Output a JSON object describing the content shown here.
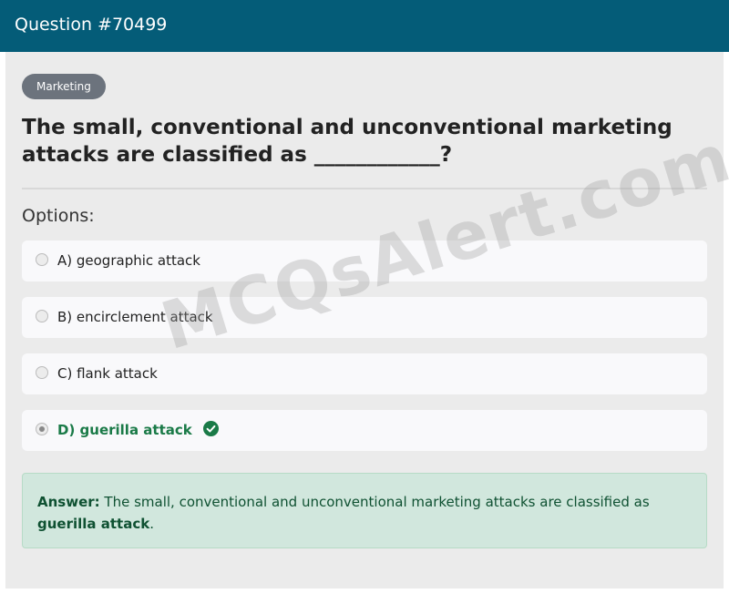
{
  "header": {
    "title": "Question #70499"
  },
  "category_badge": "Marketing",
  "question": "The small, conventional and unconventional marketing attacks are classified as ____________?",
  "options_label": "Options:",
  "options": [
    {
      "label": "A) geographic attack",
      "selected": false,
      "correct": false
    },
    {
      "label": "B) encirclement attack",
      "selected": false,
      "correct": false
    },
    {
      "label": "C) flank attack",
      "selected": false,
      "correct": false
    },
    {
      "label": "D) guerilla attack",
      "selected": true,
      "correct": true
    }
  ],
  "answer": {
    "label": "Answer:",
    "text": " The small, conventional and unconventional marketing attacks are classified as ",
    "highlight": "guerilla attack",
    "end": "."
  },
  "watermark": "MCQsAlert.com",
  "colors": {
    "header_bg": "#045c78",
    "correct_green": "#1a7a47",
    "answer_bg": "#d1e7dd"
  }
}
